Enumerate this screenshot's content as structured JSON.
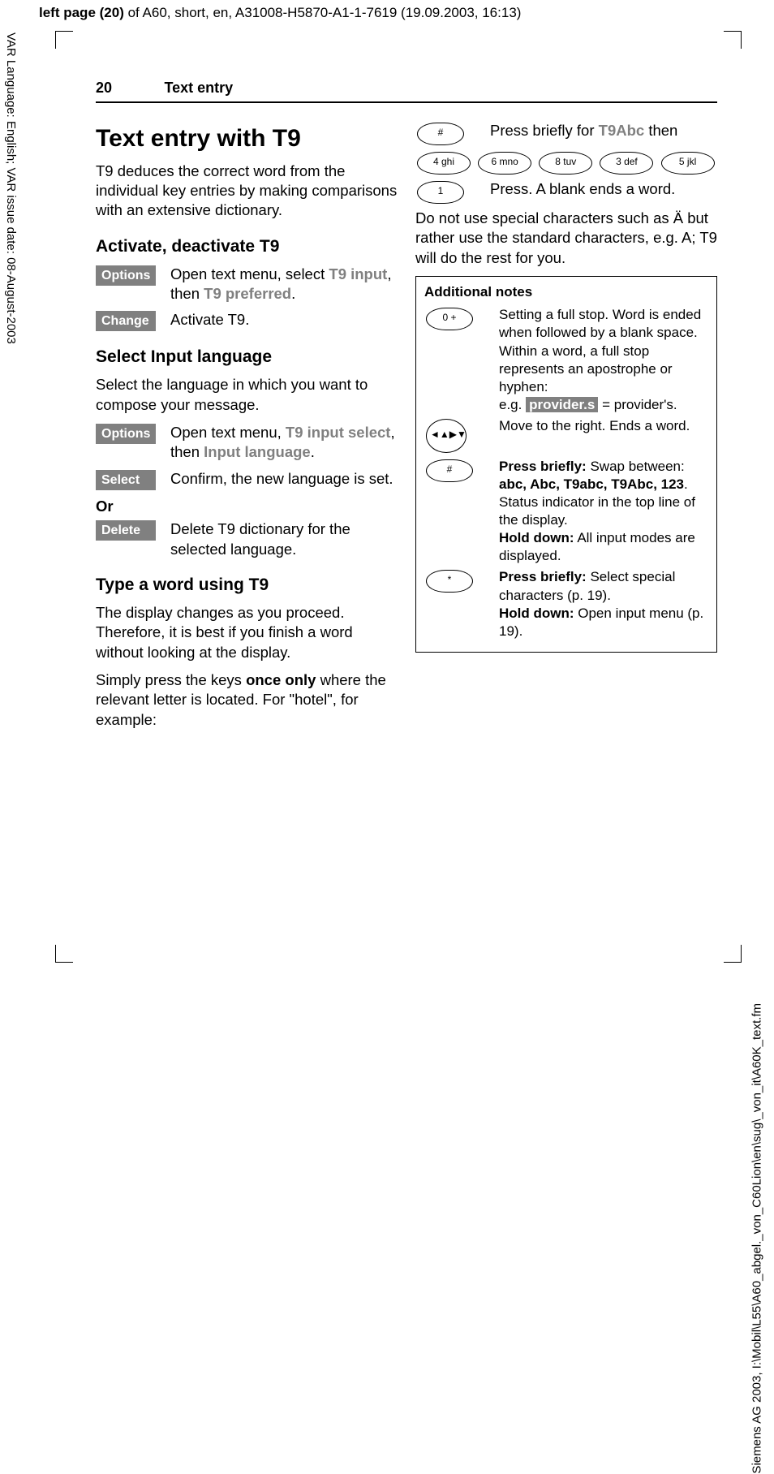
{
  "top_header": {
    "prefix": "left page (20)",
    "rest": " of A60, short, en, A31008-H5870-A1-1-7619 (19.09.2003, 16:13)"
  },
  "margin_left": "VAR Language: English; VAR issue date: 08-August-2003",
  "margin_right": "Siemens AG 2003, I:\\Mobil\\L55\\A60_abgel._von_C60Lion\\en\\sug\\_von_it\\A60K_text.fm",
  "header": {
    "page_number": "20",
    "title": "Text entry"
  },
  "left": {
    "h1": "Text entry with T9",
    "intro": "T9 deduces the correct word from the individual key entries by making comparisons with an extensive dictionary.",
    "h2_activate": "Activate, deactivate T9",
    "options_label": "Options",
    "activate_options_text_pre": "Open text menu, select ",
    "activate_options_bold1": "T9 input",
    "activate_options_text_mid": ", then ",
    "activate_options_bold2": "T9 preferred",
    "activate_options_text_end": ".",
    "change_label": "Change",
    "change_text": "Activate T9.",
    "h2_select": "Select Input language",
    "select_intro": "Select the language in which you want to compose your message.",
    "select_options_pre": "Open text menu, ",
    "select_options_bold1": "T9 input select",
    "select_options_mid": ", then ",
    "select_options_bold2": "Input language",
    "select_options_end": ".",
    "select_label": "Select",
    "select_text": "Confirm, the new language is set.",
    "or": "Or",
    "delete_label": "Delete",
    "delete_text": "Delete T9 dictionary for the selected language.",
    "h2_type": "Type a word using T9",
    "type_p1": "The display changes as you proceed. Therefore, it is best if you finish a word without looking at the display.",
    "type_p2_pre": "Simply press the keys ",
    "type_p2_bold": "once only",
    "type_p2_post": " where the relevant letter is located. For \"hotel\", for example:"
  },
  "right": {
    "hash_key": "#",
    "hash_text_pre": "Press briefly for ",
    "hash_text_bold": "T9Abc",
    "hash_text_post": " then",
    "keys": [
      "4 ghi",
      "6 mno",
      "8 tuv",
      "3 def",
      "5 jkl"
    ],
    "one_key": "1",
    "one_text": "Press. A blank ends a word.",
    "special_p": "Do not use special characters such as Ä but rather use the standard characters, e.g. A; T9 will do the rest for you.",
    "notes": {
      "title": "Additional notes",
      "zero_key": "0 +",
      "zero_text": "Setting a full stop. Word is ended when followed by a blank space. Within a word, a full stop represents an apostrophe or hyphen:",
      "eg_pre": "e.g. ",
      "eg_hl": "provider.s",
      "eg_post": " = provider's.",
      "nav_text": "Move to the right. Ends a word.",
      "hash_brief_label": "Press briefly:",
      "hash_brief_text_pre": " Swap between: ",
      "hash_brief_bold": "abc, Abc, T9abc, T9Abc, 123",
      "hash_brief_text_post": ". Status indicator in the top line of the display.",
      "hash_hold_label": "Hold down:",
      "hash_hold_text": " All input modes are displayed.",
      "star_key": "*",
      "star_brief_label": "Press briefly:",
      "star_brief_text": " Select special characters (p. 19).",
      "star_hold_label": "Hold down:",
      "star_hold_text": " Open input menu (p. 19)."
    }
  }
}
